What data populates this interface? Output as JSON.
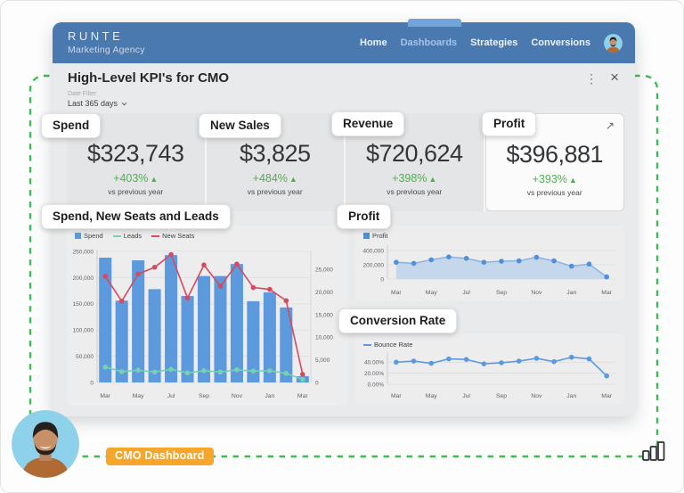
{
  "header": {
    "brand": "RUNTE",
    "subtitle": "Marketing Agency",
    "nav": [
      {
        "label": "Home"
      },
      {
        "label": "Dashboards"
      },
      {
        "label": "Strategies"
      },
      {
        "label": "Conversions"
      }
    ],
    "active_nav": "Dashboards",
    "colors": {
      "bar": "#4a79af",
      "indicator": "#72a4da",
      "active_text": "#a3c4ec"
    }
  },
  "panel": {
    "title": "High-Level KPI's for CMO",
    "kebab_icon": "⋮",
    "close_icon": "×",
    "date_filter": {
      "label": "Date Filter",
      "value": "Last 365 days"
    },
    "kpi_delta_color": "#4caf50",
    "kpis": [
      {
        "value": "$323,743",
        "delta": "+403%",
        "delta_dir": "▲",
        "note": "vs previous year"
      },
      {
        "value": "$3,825",
        "delta": "+484%",
        "delta_dir": "▲",
        "note": "vs previous year"
      },
      {
        "value": "$720,624",
        "delta": "+398%",
        "delta_dir": "▲",
        "note": "vs previous year"
      },
      {
        "value": "$396,881",
        "delta": "+393%",
        "delta_dir": "▲",
        "note": "vs previous year",
        "expand_icon": "↗"
      }
    ]
  },
  "annotations": {
    "dash_color": "#3dbd51",
    "chips": [
      {
        "label": "Spend"
      },
      {
        "label": "New Sales"
      },
      {
        "label": "Revenue"
      },
      {
        "label": "Profit"
      },
      {
        "label": "Spend, New Seats and Leads"
      },
      {
        "label": "Profit"
      },
      {
        "label": "Conversion Rate"
      }
    ],
    "badge": {
      "label": "CMO Dashboard",
      "color": "#f5a62b"
    }
  },
  "chart_data": [
    {
      "id": "spend-new-seats-leads",
      "type": "bar",
      "title": "Spend, New Seats and Leads",
      "categories": [
        "Mar",
        "Apr",
        "May",
        "Jun",
        "Jul",
        "Aug",
        "Sep",
        "Oct",
        "Nov",
        "Dec",
        "Jan",
        "Feb",
        "Mar"
      ],
      "x_tick_labels": [
        "Mar",
        "May",
        "Jul",
        "Sep",
        "Nov",
        "Jan",
        "Mar"
      ],
      "legend_position": "top-left",
      "grid": true,
      "series": [
        {
          "name": "Spend",
          "type": "bar",
          "axis": "left",
          "color": "#5d9add",
          "values": [
            238000,
            156000,
            233000,
            178000,
            243000,
            165000,
            203000,
            203000,
            226000,
            155000,
            172000,
            143000,
            12000
          ]
        },
        {
          "name": "Leads",
          "type": "line",
          "axis": "right",
          "color": "#74d3ae",
          "values": [
            3400,
            2400,
            2700,
            2300,
            2900,
            2100,
            2600,
            2300,
            2800,
            2500,
            2600,
            2000,
            700
          ]
        },
        {
          "name": "New Seats",
          "type": "line",
          "axis": "right",
          "color": "#d8495f",
          "values": [
            23500,
            18000,
            24000,
            25500,
            28300,
            18700,
            26000,
            21300,
            26200,
            21000,
            20600,
            18100,
            1800
          ]
        }
      ],
      "left_axis": {
        "tick_labels": [
          "250,000",
          "200,000",
          "150,000",
          "100,000",
          "50,000",
          "0"
        ],
        "tick_values": [
          250000,
          200000,
          150000,
          100000,
          50000,
          0
        ],
        "plot_max": 250000
      },
      "right_axis": {
        "tick_labels": [
          "25,000",
          "20,000",
          "15,000",
          "10,000",
          "5,000",
          "0"
        ],
        "tick_values": [
          25000,
          20000,
          15000,
          10000,
          5000,
          0
        ],
        "plot_max": 29000
      }
    },
    {
      "id": "profit-trend",
      "type": "area",
      "title": "Profit",
      "categories": [
        "Mar",
        "Apr",
        "May",
        "Jun",
        "Jul",
        "Aug",
        "Sep",
        "Oct",
        "Nov",
        "Dec",
        "Jan",
        "Feb",
        "Mar"
      ],
      "x_tick_labels": [
        "Mar",
        "May",
        "Jul",
        "Sep",
        "Nov",
        "Jan",
        "Mar"
      ],
      "legend_position": "top-left",
      "grid": true,
      "series": [
        {
          "name": "Profit",
          "type": "line",
          "color": "#4f90d8",
          "line_color": "#8fb4e0",
          "fill": "#bdd2ea",
          "values": [
            235000,
            220000,
            270000,
            310000,
            290000,
            235000,
            250000,
            255000,
            305000,
            255000,
            180000,
            210000,
            30000
          ]
        }
      ],
      "y_axis": {
        "tick_labels": [
          "400,000",
          "200,000",
          "0"
        ],
        "tick_values": [
          400000,
          200000,
          0
        ],
        "plot_max": 450000
      }
    },
    {
      "id": "bounce-rate",
      "type": "line",
      "title": "Conversion Rate",
      "categories": [
        "Mar",
        "Apr",
        "May",
        "Jun",
        "Jul",
        "Aug",
        "Sep",
        "Oct",
        "Nov",
        "Dec",
        "Jan",
        "Feb",
        "Mar"
      ],
      "x_tick_labels": [
        "Mar",
        "May",
        "Jul",
        "Sep",
        "Nov",
        "Jan",
        "Mar"
      ],
      "legend_position": "top-left",
      "grid": true,
      "series": [
        {
          "name": "Bounce Rate",
          "type": "line",
          "color": "#5d9add",
          "values": [
            40,
            42,
            38,
            46,
            45,
            37,
            39,
            42,
            47,
            41,
            49,
            46,
            15
          ]
        }
      ],
      "y_axis": {
        "tick_labels": [
          "40.00%",
          "20.00%",
          "0.00%"
        ],
        "tick_values": [
          40,
          20,
          0
        ],
        "plot_max": 55
      }
    }
  ]
}
